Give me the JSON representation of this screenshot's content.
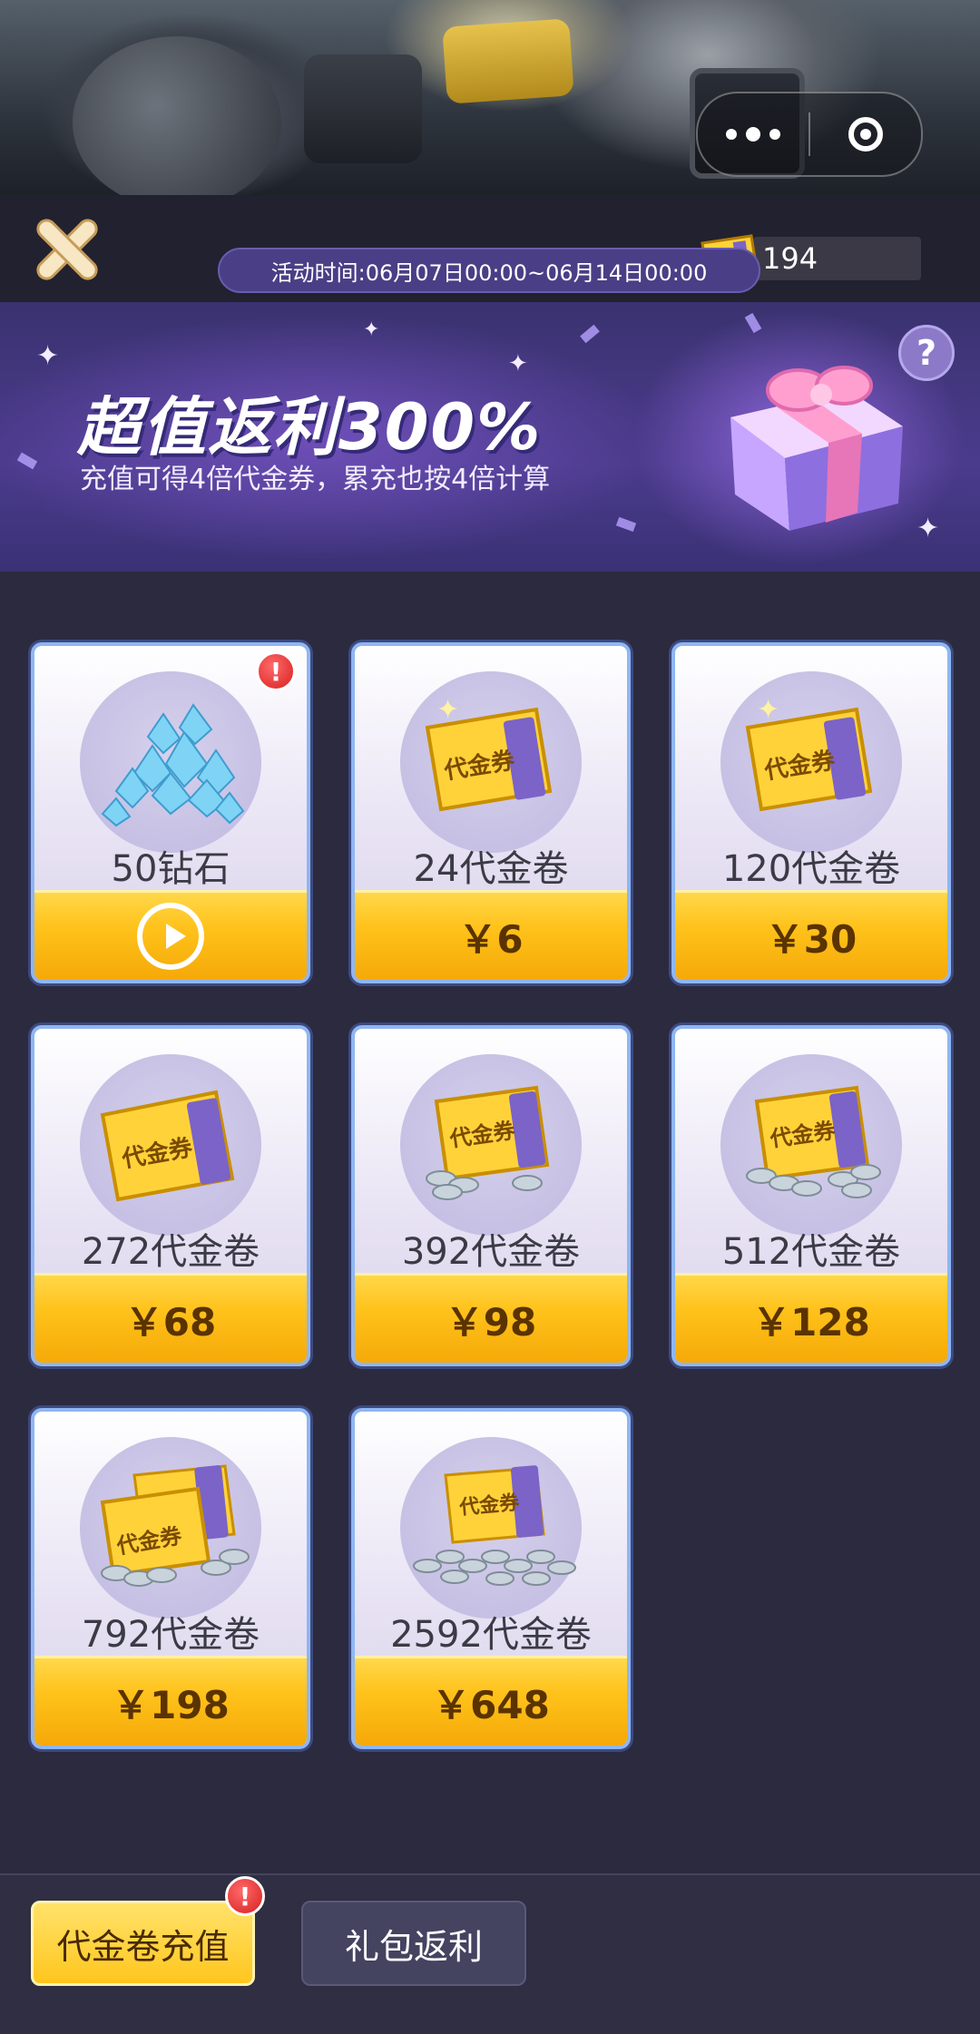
{
  "balance": {
    "value": "194",
    "icon": "coupon-icon"
  },
  "banner": {
    "title": "超值返利300%",
    "subtitle": "充值可得4倍代金券，累充也按4倍计算",
    "period": "活动时间:06月07日00:00~06月14日00:00",
    "help_icon": "question-icon",
    "help_text": "?"
  },
  "coupon_text": "代金券",
  "alert_text": "!",
  "items": [
    {
      "label": "50钻石",
      "price": "",
      "action": "play-icon",
      "art": "diamond-pile",
      "badge": true
    },
    {
      "label": "24代金卷",
      "price": "￥6",
      "art": "coupon"
    },
    {
      "label": "120代金卷",
      "price": "￥30",
      "art": "coupon"
    },
    {
      "label": "272代金卷",
      "price": "￥68",
      "art": "coupon"
    },
    {
      "label": "392代金卷",
      "price": "￥98",
      "art": "coupon-with-coins"
    },
    {
      "label": "512代金卷",
      "price": "￥128",
      "art": "coupon-with-coins"
    },
    {
      "label": "792代金卷",
      "price": "￥198",
      "art": "coupons-with-coins"
    },
    {
      "label": "2592代金卷",
      "price": "￥648",
      "art": "coupons-with-many-coins"
    }
  ],
  "tabs": [
    {
      "label": "代金卷充值",
      "active": true,
      "badge": true
    },
    {
      "label": "礼包返利",
      "active": false
    }
  ],
  "colors": {
    "accent": "#ffc21b",
    "card_border": "#8fb6f2",
    "banner": "#4b3b8c"
  }
}
